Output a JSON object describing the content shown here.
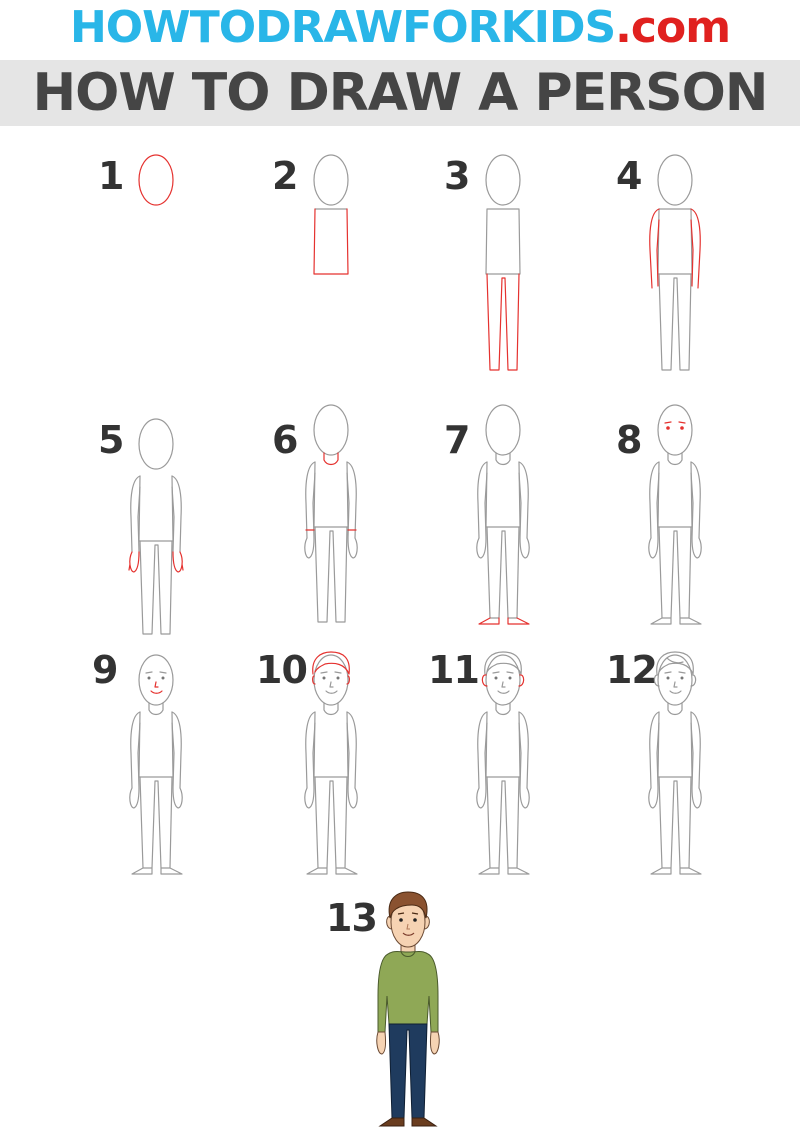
{
  "header": {
    "site_name": "HOWTODRAWFORKIDS",
    "site_tld": ".com",
    "title": "HOW TO DRAW A PERSON"
  },
  "steps": [
    {
      "label": "1"
    },
    {
      "label": "2"
    },
    {
      "label": "3"
    },
    {
      "label": "4"
    },
    {
      "label": "5"
    },
    {
      "label": "6"
    },
    {
      "label": "7"
    },
    {
      "label": "8"
    },
    {
      "label": "9"
    },
    {
      "label": "10"
    },
    {
      "label": "11"
    },
    {
      "label": "12"
    },
    {
      "label": "13"
    }
  ],
  "colors": {
    "site_name": "#29b6e8",
    "site_tld": "#e0211f",
    "title_bar": "#e5e5e5",
    "title_text": "#454545",
    "sketch_line": "#9a9a9a",
    "new_line": "#e5322f",
    "shirt": "#8fa856",
    "pants": "#1f3b5e",
    "hair": "#8a5230",
    "skin": "#f6d3b3"
  }
}
